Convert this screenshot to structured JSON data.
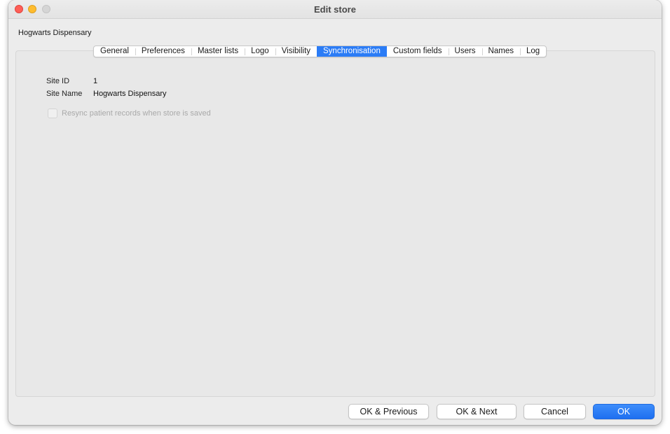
{
  "window": {
    "title": "Edit store"
  },
  "store": {
    "name": "Hogwarts Dispensary"
  },
  "tabs": [
    {
      "label": "General",
      "active": false
    },
    {
      "label": "Preferences",
      "active": false
    },
    {
      "label": "Master lists",
      "active": false
    },
    {
      "label": "Logo",
      "active": false
    },
    {
      "label": "Visibility",
      "active": false
    },
    {
      "label": "Synchronisation",
      "active": true
    },
    {
      "label": "Custom fields",
      "active": false
    },
    {
      "label": "Users",
      "active": false
    },
    {
      "label": "Names",
      "active": false
    },
    {
      "label": "Log",
      "active": false
    }
  ],
  "sync": {
    "site_id_label": "Site ID",
    "site_id_value": "1",
    "site_name_label": "Site Name",
    "site_name_value": "Hogwarts Dispensary",
    "resync_label": "Resync patient records when store is saved",
    "resync_checked": false,
    "resync_enabled": false
  },
  "buttons": {
    "ok_previous": "OK & Previous",
    "ok_next": "OK & Next",
    "cancel": "Cancel",
    "ok": "OK"
  },
  "colors": {
    "accent": "#2b7cf6",
    "close": "#fe5f57",
    "minimize": "#febc2e",
    "maximize": "#d5d5d5"
  }
}
